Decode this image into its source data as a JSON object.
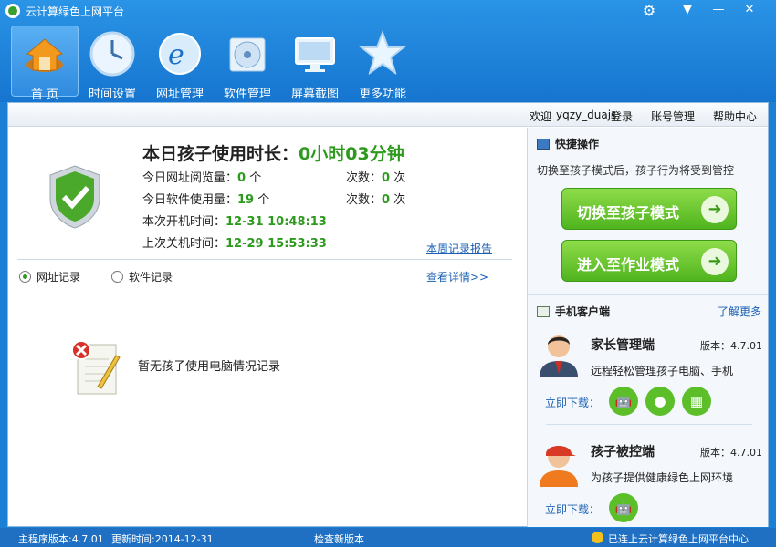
{
  "app": {
    "title": "云计算绿色上网平台"
  },
  "window": {
    "settings_icon": "gear-icon",
    "menu_symbol": "▼",
    "minimize_symbol": "—",
    "close_symbol": "✕"
  },
  "nav": {
    "items": [
      {
        "label": "首 页",
        "icon": "home-icon"
      },
      {
        "label": "时间设置",
        "icon": "clock-icon"
      },
      {
        "label": "网址管理",
        "icon": "browser-icon"
      },
      {
        "label": "软件管理",
        "icon": "disc-icon"
      },
      {
        "label": "屏幕截图",
        "icon": "monitor-icon"
      },
      {
        "label": "更多功能",
        "icon": "star-icon"
      }
    ]
  },
  "userbar": {
    "welcome": "欢迎",
    "username": "yqzy_duajs",
    "login": "登录",
    "account": "账号管理",
    "help": "帮助中心"
  },
  "summary": {
    "headline_prefix": "本日孩子使用时长：",
    "hours": "0",
    "hours_unit": "小时",
    "minutes": "03",
    "minutes_unit": "分钟",
    "url_label": "今日网址阅览量：",
    "url_count": "0",
    "url_unit": "个",
    "url_times_label": "次数：",
    "url_times": "0",
    "url_times_unit": "次",
    "soft_label": "今日软件使用量：",
    "soft_count": "19",
    "soft_unit": "个",
    "soft_times_label": "次数：",
    "soft_times": "0",
    "soft_times_unit": "次",
    "boot_label": "本次开机时间：",
    "boot_time": "12-31 10:48:13",
    "shutdown_label": "上次关机时间：",
    "shutdown_time": "12-29 15:53:33",
    "weekly_report": "本周记录报告"
  },
  "records": {
    "tab_url": "网址记录",
    "tab_soft": "软件记录",
    "details_link": "查看详情>>",
    "empty_text": "暂无孩子使用电脑情况记录"
  },
  "quick": {
    "title": "快捷操作",
    "hint": "切换至孩子模式后，孩子行为将受到管控",
    "child_mode": "切换至孩子模式",
    "homework_mode": "进入至作业模式"
  },
  "mobile": {
    "title": "手机客户端",
    "more": "了解更多",
    "parent": {
      "name": "家长管理端",
      "version": "版本：4.7.01",
      "desc": "远程轻松管理孩子电脑、手机",
      "download": "立即下载："
    },
    "child": {
      "name": "孩子被控端",
      "version": "版本：4.7.01",
      "desc": "为孩子提供健康绿色上网环境",
      "download": "立即下载："
    }
  },
  "status": {
    "version": "主程序版本:4.7.01",
    "update": "更新时间:2014-12-31",
    "check": "检查新版本",
    "connected": "已连上云计算绿色上网平台中心"
  },
  "colors": {
    "accent": "#1675cf",
    "green": "#2d9a1e",
    "button_green": "#4fb41e"
  }
}
